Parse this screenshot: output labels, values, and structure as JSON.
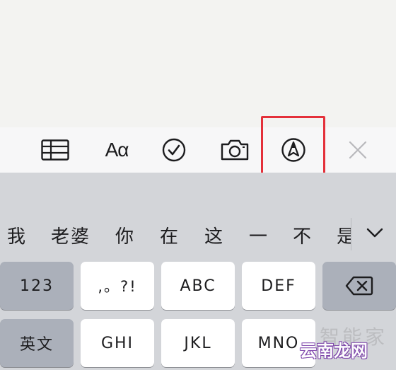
{
  "toolbar": {
    "table_icon": "table-icon",
    "format_label": "Aα",
    "checklist_icon": "checklist-icon",
    "camera_icon": "camera-icon",
    "markup_icon": "markup-pen-icon",
    "close_icon": "close-icon"
  },
  "candidates": [
    "我",
    "老婆",
    "你",
    "在",
    "这",
    "一",
    "不",
    "是"
  ],
  "keyboard": {
    "row1": [
      "123",
      ",。?!",
      "ABC",
      "DEF",
      "delete-icon"
    ],
    "row2": [
      "英文",
      "GHI",
      "JKL",
      "MNO"
    ]
  },
  "watermark": {
    "text": "云南龙网",
    "faint": "智能家"
  },
  "colors": {
    "highlight": "#e4303a",
    "keyboard_bg": "#d3d5d9",
    "func_key": "#abb0ba",
    "key": "#ffffff"
  }
}
